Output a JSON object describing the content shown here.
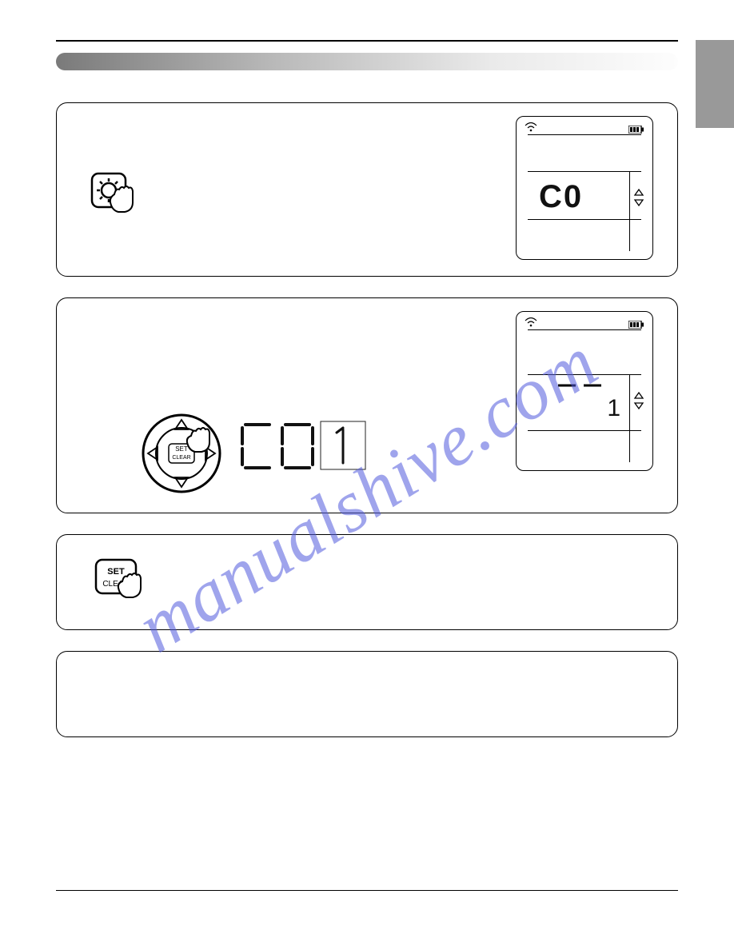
{
  "watermark_text": "manualshive.com",
  "step1": {
    "lcd": {
      "segment_main": "C0"
    }
  },
  "step2": {
    "lcd": {
      "segment_small": "1"
    },
    "inline_segment": "C0 1",
    "dpad_center_top": "SET",
    "dpad_center_bottom": "CLEAR"
  },
  "step3": {
    "button_top": "SET",
    "button_bottom": "CLEAR"
  },
  "icons": {
    "wifi": "wifi-icon",
    "battery": "battery-icon",
    "updown": "up-down-arrow-icon",
    "gear": "gear-icon",
    "hand": "hand-pointer-icon"
  }
}
